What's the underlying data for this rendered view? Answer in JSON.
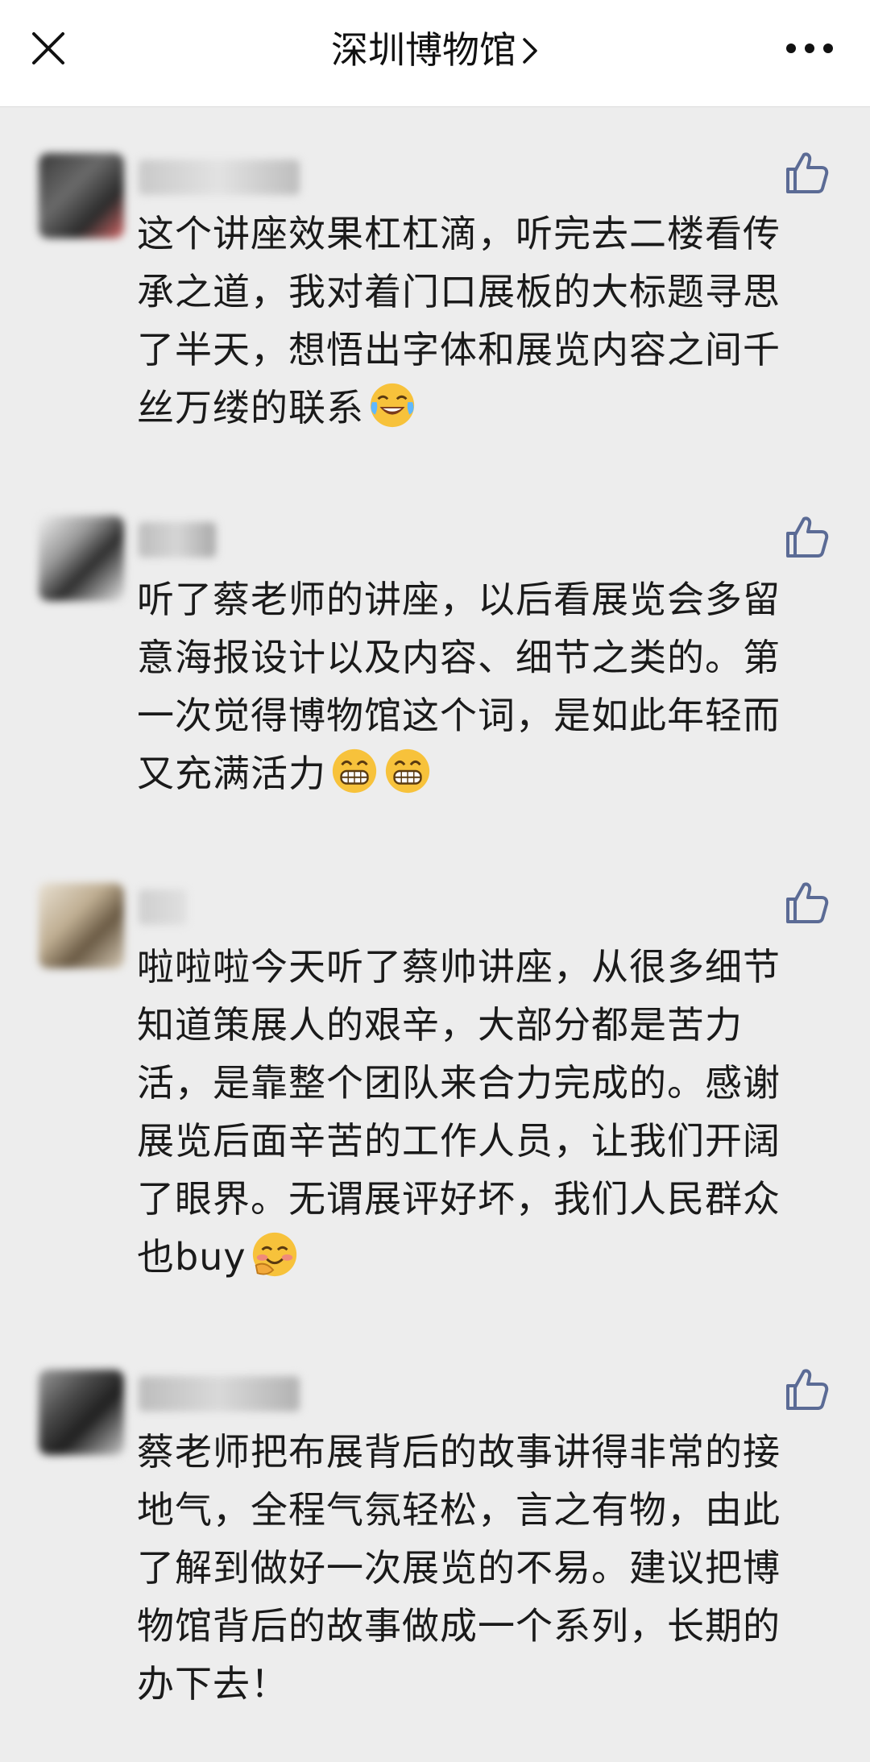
{
  "header": {
    "title": "深圳博物馆",
    "close_icon": "close-icon",
    "more_icon": "more-icon"
  },
  "comments": [
    {
      "text": "这个讲座效果杠杠滴，听完去二楼看传承之道，我对着门口展板的大标题寻思了半天，想悟出字体和展览内容之间千丝万缕的联系",
      "emojis": [
        "tears-of-joy-emoji"
      ]
    },
    {
      "text": "听了蔡老师的讲座，以后看展览会多留意海报设计以及内容、细节之类的。第一次觉得博物馆这个词，是如此年轻而又充满活力",
      "emojis": [
        "grinning-emoji",
        "grinning-emoji"
      ]
    },
    {
      "text": "啦啦啦今天听了蔡帅讲座，从很多细节知道策展人的艰辛，大部分都是苦力活，是靠整个团队来合力完成的。感谢展览后面辛苦的工作人员，让我们开阔了眼界。无谓展评好坏，我们人民群众也buy",
      "emojis": [
        "giggle-emoji"
      ]
    },
    {
      "text": "蔡老师把布展背后的故事讲得非常的接地气，全程气氛轻松，言之有物，由此了解到做好一次展览的不易。建议把博物馆背后的故事做成一个系列，长期的办下去！",
      "emojis": []
    }
  ],
  "colors": {
    "background": "#ededed",
    "navbar": "#ffffff",
    "text": "#1a1a1a",
    "like_icon": "#5b6b95",
    "emoji_yellow": "#f7c23b"
  }
}
